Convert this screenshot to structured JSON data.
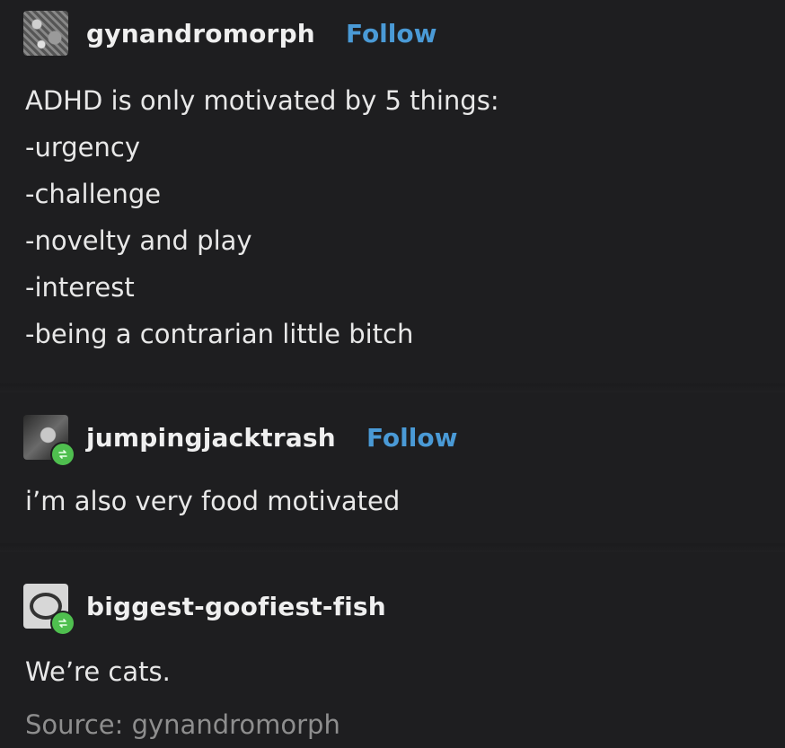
{
  "posts": [
    {
      "username": "gynandromorph",
      "follow_label": "Follow",
      "avatar_icon": "avatar-image",
      "lines": [
        "ADHD is only motivated by 5 things:",
        "-urgency",
        "-challenge",
        "-novelty and play",
        "-interest",
        "-being a contrarian little bitch"
      ]
    },
    {
      "username": "jumpingjacktrash",
      "follow_label": "Follow",
      "avatar_icon": "avatar-image",
      "badge_icon": "reblog-icon",
      "text": "i’m also very food motivated"
    },
    {
      "username": "biggest-goofiest-fish",
      "avatar_icon": "avatar-image",
      "badge_icon": "reblog-icon",
      "text": "We’re cats."
    }
  ],
  "source": {
    "label": "Source: gynandromorph"
  },
  "colors": {
    "background": "#1e1e20",
    "text": "#e8e8e8",
    "follow": "#4a9ad6",
    "muted": "#8e8e8e",
    "reblog_badge": "#4fbf4f"
  }
}
